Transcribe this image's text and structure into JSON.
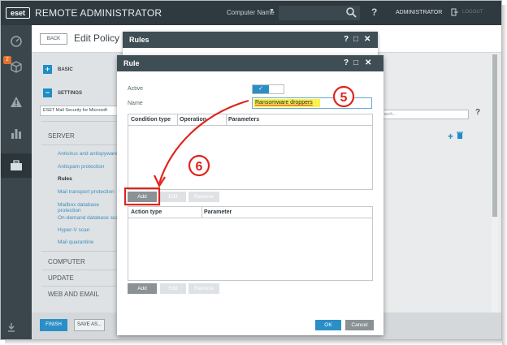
{
  "header": {
    "logo": "eset",
    "brand": "REMOTE ADMINISTRATOR",
    "computer_name": "Computer Name",
    "user": "ADMINISTRATOR",
    "logout": "LOGOUT"
  },
  "page": {
    "back": "BACK",
    "title": "Edit Policy - S"
  },
  "left_panel": {
    "basic": "BASIC",
    "settings": "SETTINGS",
    "product": "ESET Mail Security for Microsoft",
    "server": "SERVER",
    "server_items": [
      "Antivirus and antispyware",
      "Antispam protection",
      "Rules",
      "Mail transport protection",
      "Mailbox database protection",
      "On-demand database scan",
      "Hyper-V scan",
      "Mail quarantine"
    ],
    "computer": "COMPUTER",
    "update": "UPDATE",
    "web_email": "WEB AND EMAIL"
  },
  "right": {
    "search_placeholder": "Search..."
  },
  "footer": {
    "finish": "FINISH",
    "save_as": "SAVE AS..."
  },
  "rules_dialog": {
    "title": "Rules"
  },
  "rule_dialog": {
    "title": "Rule",
    "active_label": "Active",
    "name_label": "Name",
    "name_value": "Ransomware droppers",
    "conditions": {
      "columns": [
        "Condition type",
        "Operation",
        "Parameters"
      ]
    },
    "actions": {
      "columns": [
        "Action type",
        "Parameter"
      ]
    },
    "buttons": {
      "add": "Add",
      "edit": "Edit",
      "remove": "Remove"
    },
    "ok": "OK",
    "cancel": "Cancel"
  },
  "annotations": {
    "step5": "5",
    "step6": "6"
  },
  "colors": {
    "accent": "#2a8fc7",
    "annotation": "#e0241c",
    "highlight": "#fbf24a",
    "dark": "#2f3a40"
  }
}
